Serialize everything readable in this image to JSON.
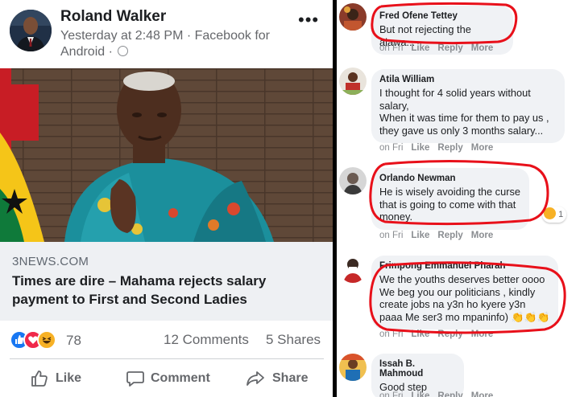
{
  "post": {
    "author": "Roland Walker",
    "timestamp": "Yesterday at 2:48 PM · Facebook for Android ·",
    "more_icon": "more-horizontal-icon",
    "photo_icon": "news-photo",
    "link": {
      "source": "3NEWS.COM",
      "title": "Times are dire – Mahama rejects salary payment to First and Second Ladies"
    },
    "reactions": [
      "like",
      "love",
      "haha"
    ],
    "reaction_count": "78",
    "comments_count": "12 Comments",
    "shares_count": "5 Shares",
    "actions": {
      "like": "Like",
      "comment": "Comment",
      "share": "Share"
    }
  },
  "comment_actions": {
    "like": "Like",
    "reply": "Reply",
    "more": "More",
    "time": "on Fri"
  },
  "comments": [
    {
      "name": "Fred Ofene Tettey",
      "text": "But not rejecting the alawa..."
    },
    {
      "name": "Atila William",
      "text": "I thought for 4 solid years without salary,\nWhen it was time for them to pay us , they gave us only 3 months salary..."
    },
    {
      "name": "Orlando Newman",
      "text": "He is wisely avoiding the curse that is going to come with that money."
    },
    {
      "name": "Frimpong Emmanuel Pharah",
      "text": "We the youths deserves better oooo We beg you our politicians , kindly create jobs na y3n ho kyere y3n paaa Me ser3 mo mpaninfo) 👏👏👏"
    },
    {
      "name": "Issah B. Mahmoud",
      "text": "Good step"
    }
  ],
  "reaction_badge": {
    "count": "1"
  },
  "colors": {
    "annotation_red": "#e8101a",
    "link_bg": "#eef0f3",
    "meta_gray": "#65676b"
  }
}
